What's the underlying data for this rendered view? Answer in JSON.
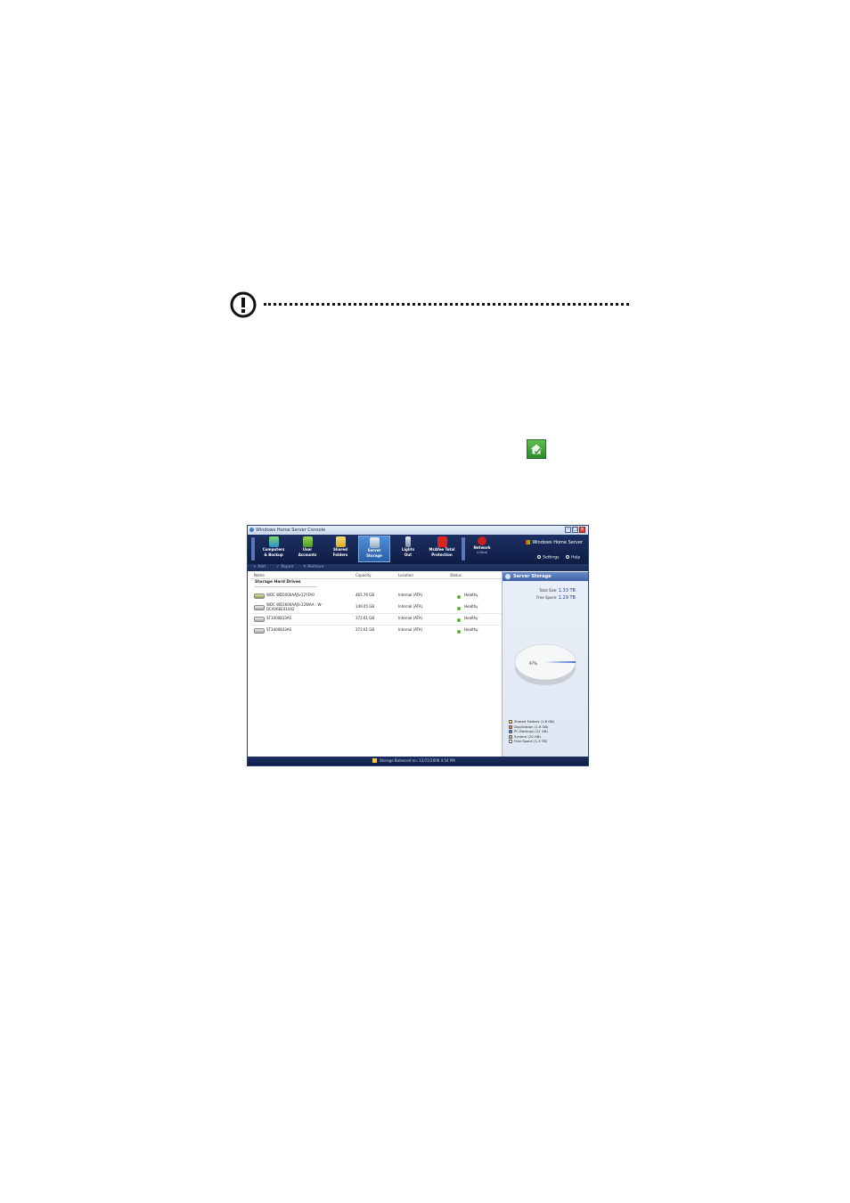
{
  "window": {
    "title": "Windows Home Server Console",
    "brand": "Windows Home Server",
    "settings_label": "Settings",
    "help_label": "Help"
  },
  "nav": [
    {
      "line1": "Computers",
      "line2": "& Backup",
      "sub": ""
    },
    {
      "line1": "User",
      "line2": "Accounts",
      "sub": ""
    },
    {
      "line1": "Shared",
      "line2": "Folders",
      "sub": ""
    },
    {
      "line1": "Server",
      "line2": "Storage",
      "sub": ""
    },
    {
      "line1": "Lights",
      "line2": "Out",
      "sub": ""
    },
    {
      "line1": "McAfee Total",
      "line2": "Protection",
      "sub": ""
    },
    {
      "line1": "Network",
      "line2": "",
      "sub": "Critical"
    }
  ],
  "toolbar": {
    "add": "Add",
    "repair": "Repair",
    "remove": "Remove"
  },
  "table": {
    "columns": [
      "Name",
      "Capacity",
      "Location",
      "Status"
    ],
    "group_title": "Storage Hard Drives",
    "rows": [
      {
        "name": "WDC WD5000AAJS-22YFA0",
        "name2": "",
        "capacity": "465.76 GB",
        "location": "Internal (ATA)",
        "status": "Healthy"
      },
      {
        "name": "WDC WD1600AAJS-22WAA - W-",
        "name2": "DCAV6EE41442",
        "capacity": "149.05 GB",
        "location": "Internal (ATA)",
        "status": "Healthy"
      },
      {
        "name": "ST3400833AS",
        "name2": "",
        "capacity": "372.61 GB",
        "location": "Internal (ATA)",
        "status": "Healthy"
      },
      {
        "name": "ST3400833AS",
        "name2": "",
        "capacity": "372.61 GB",
        "location": "Internal (ATA)",
        "status": "Healthy"
      }
    ]
  },
  "side": {
    "title": "Server Storage",
    "total_label": "Total Size:",
    "total_value": "1.33 TB",
    "free_label": "Free Space:",
    "free_value": "1.29 TB",
    "pie_label": "97%",
    "legend": [
      {
        "label": "Shared Folders (1.6 GB)",
        "color": "#f2d633"
      },
      {
        "label": "Duplication (1.6 GB)",
        "color": "#e3842c"
      },
      {
        "label": "PC Backups (22 GB)",
        "color": "#4a6fd0"
      },
      {
        "label": "System (20 GB)",
        "color": "#b8b8a0"
      },
      {
        "label": "Free Space (1.3 TB)",
        "color": "#ffffff"
      }
    ]
  },
  "statusbar": {
    "text": "Storage Balanced on: 12/11/2008 4:54 PM"
  },
  "colors": {
    "ribbon": "#14255a",
    "accent": "#3e63a6",
    "healthy": "#57b32e"
  }
}
